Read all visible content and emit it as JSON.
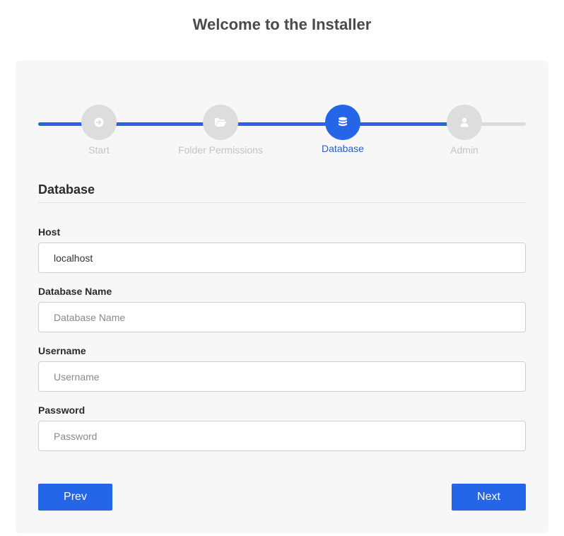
{
  "page": {
    "title": "Welcome to the Installer"
  },
  "colors": {
    "accent": "#2566e8",
    "inactive_step": "#dddddd",
    "card_bg": "#f7f7f7"
  },
  "stepper": {
    "steps": [
      {
        "label": "Start",
        "icon": "arrow-circle-right-icon",
        "state": "completed"
      },
      {
        "label": "Folder Permissions",
        "icon": "folder-open-icon",
        "state": "completed"
      },
      {
        "label": "Database",
        "icon": "database-icon",
        "state": "active"
      },
      {
        "label": "Admin",
        "icon": "user-icon",
        "state": "pending"
      }
    ]
  },
  "section": {
    "title": "Database"
  },
  "form": {
    "host": {
      "label": "Host",
      "value": "localhost",
      "placeholder": "Host"
    },
    "database_name": {
      "label": "Database Name",
      "value": "",
      "placeholder": "Database Name"
    },
    "username": {
      "label": "Username",
      "value": "",
      "placeholder": "Username"
    },
    "password": {
      "label": "Password",
      "value": "",
      "placeholder": "Password"
    }
  },
  "buttons": {
    "prev": "Prev",
    "next": "Next"
  }
}
